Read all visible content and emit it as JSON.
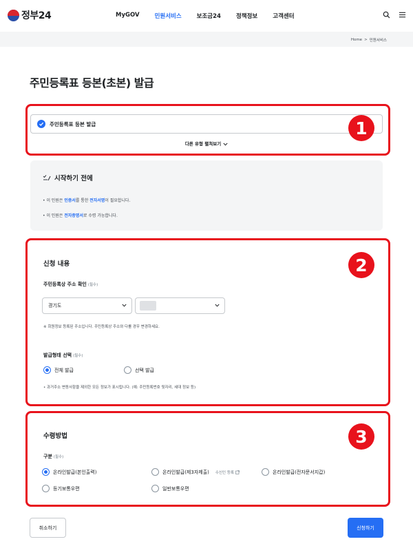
{
  "header": {
    "logo_text": "정부24",
    "nav": [
      "MyGOV",
      "민원서비스",
      "보조금24",
      "정책정보",
      "고객센터"
    ],
    "active_nav": "민원서비스"
  },
  "breadcrumb": {
    "home": "Home",
    "sep": ">",
    "current": "민원서비스"
  },
  "page_title": "주민등록표 등본(초본) 발급",
  "section1": {
    "selected_type": "주민등록표 등본 발급",
    "other_types_label": "다른 유형 펼쳐보기"
  },
  "before_start": {
    "title": "시작하기 전에",
    "line1": {
      "pre": "이 민원은 ",
      "hl1": "인증서",
      "mid": "를 통한 ",
      "hl2": "전자서명",
      "post": "이 필요합니다."
    },
    "line2": {
      "pre": "이 민원은 ",
      "hl1": "전자증명서",
      "post": "로 수령 가능합니다."
    }
  },
  "application": {
    "title": "신청 내용",
    "address_label": "주민등록상 주소 확인",
    "required": "(필수)",
    "province_value": "경기도",
    "city_value": "",
    "address_note": "※ 회원정보 등록된 주소입니다. 주민등록상 주소와 다를 경우 변경하세요.",
    "issue_label": "발급형태 선택",
    "issue_options": [
      "전체 발급",
      "선택 발급"
    ],
    "issue_selected": "전체 발급",
    "issue_note": "• 과거주소 변동사항을 제외한 모든 정보가 표시됩니다. (예: 주민등록번호 뒷자리, 세대 정보 등)"
  },
  "receive": {
    "title": "수령방법",
    "category_label": "구분",
    "required": "(필수)",
    "options": [
      "온라인발급(본인출력)",
      "온라인발급(제3자제출)",
      "온라인발급(전자문서지갑)",
      "등기보통우편",
      "일반보통우편"
    ],
    "selected": "온라인발급(본인출력)",
    "receiver_link": "수신인 등록"
  },
  "annotations": [
    "1",
    "2",
    "3"
  ],
  "buttons": {
    "cancel": "취소하기",
    "apply": "신청하기"
  },
  "colors": {
    "primary": "#256ef4",
    "annotation": "#e8121c"
  }
}
